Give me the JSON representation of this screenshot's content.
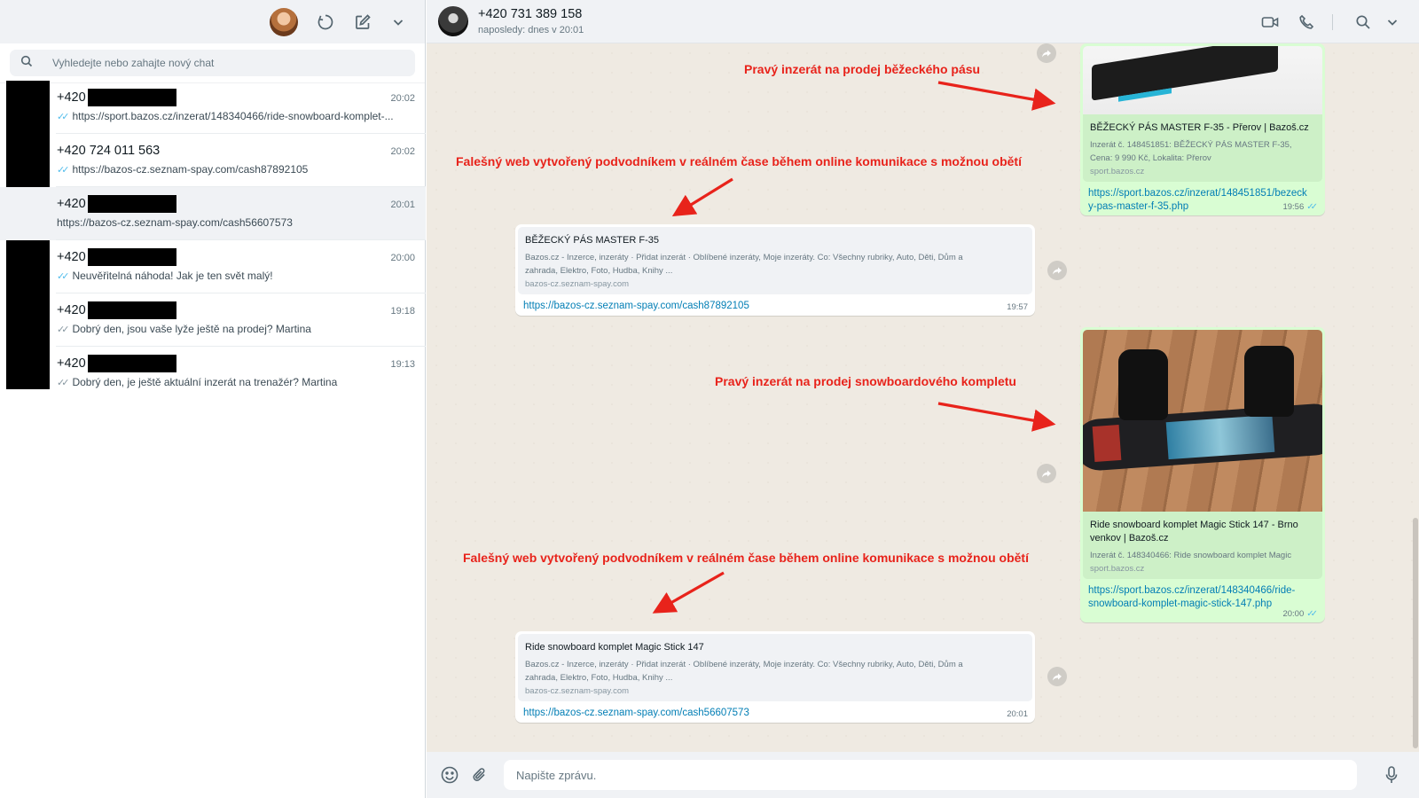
{
  "sidebar": {
    "search_placeholder": "Vyhledejte nebo zahajte nový chat",
    "icons": [
      "avatar",
      "status-icon",
      "new-chat-icon",
      "chevron-down-icon",
      "search-icon"
    ],
    "chats": [
      {
        "name": "+420",
        "time": "20:02",
        "preview": "https://sport.bazos.cz/inzerat/148340466/ride-snowboard-komplet-...",
        "ticks": "read"
      },
      {
        "name": "+420 724 011 563",
        "time": "20:02",
        "preview": "https://bazos-cz.seznam-spay.com/cash87892105",
        "ticks": "read"
      },
      {
        "name": "+420",
        "time": "20:01",
        "preview": "https://bazos-cz.seznam-spay.com/cash56607573",
        "ticks": "none"
      },
      {
        "name": "+420",
        "time": "20:00",
        "preview": "Neuvěřitelná náhoda! Jak je ten svět malý!",
        "ticks": "read"
      },
      {
        "name": "+420",
        "time": "19:18",
        "preview": "Dobrý den, jsou vaše lyže ještě na prodej? Martina",
        "ticks": "sent"
      },
      {
        "name": "+420",
        "time": "19:13",
        "preview": "Dobrý den, je ještě aktuální inzerát na trenažér? Martina",
        "ticks": "sent"
      }
    ]
  },
  "conversation": {
    "contact_name": "+420 731 389 158",
    "contact_status": "naposledy: dnes v 20:01",
    "input_placeholder": "Napište zprávu.",
    "messages": {
      "m1": {
        "title": "BĚŽECKÝ PÁS MASTER F-35 - Přerov | Bazoš.cz",
        "desc1": "Inzerát č. 148451851: BĚŽECKÝ PÁS MASTER F-35,",
        "desc2": "Cena: 9 990 Kč, Lokalita: Přerov",
        "domain": "sport.bazos.cz",
        "link1": "https://sport.bazos.cz/inzerat/148451851/bezeck",
        "link2": "y-pas-master-f-35.php",
        "time": "19:56"
      },
      "m2": {
        "title": "BĚŽECKÝ PÁS MASTER F-35",
        "desc1": "Bazos.cz - Inzerce, inzeráty · Přidat inzerát · Oblíbené inzeráty, Moje inzeráty. Co: Všechny rubriky, Auto, Děti, Dům a",
        "desc2": "zahrada, Elektro, Foto, Hudba, Knihy ...",
        "domain": "bazos-cz.seznam-spay.com",
        "link": "https://bazos-cz.seznam-spay.com/cash87892105",
        "time": "19:57"
      },
      "m3": {
        "title1": "Ride snowboard komplet Magic Stick 147 - Brno",
        "title2": "venkov | Bazoš.cz",
        "desc": "Inzerát č. 148340466: Ride snowboard komplet Magic",
        "domain": "sport.bazos.cz",
        "link1": "https://sport.bazos.cz/inzerat/148340466/ride-",
        "link2": "snowboard-komplet-magic-stick-147.php",
        "time": "20:00"
      },
      "m4": {
        "title": "Ride snowboard komplet Magic Stick 147",
        "desc1": "Bazos.cz - Inzerce, inzeráty · Přidat inzerát · Oblíbené inzeráty, Moje inzeráty. Co: Všechny rubriky, Auto, Děti, Dům a",
        "desc2": "zahrada, Elektro, Foto, Hudba, Knihy ...",
        "domain": "bazos-cz.seznam-spay.com",
        "link": "https://bazos-cz.seznam-spay.com/cash56607573",
        "time": "20:01"
      }
    }
  },
  "annotations": {
    "a1": "Pravý inzerát na prodej běžeckého pásu",
    "a2": "Falešný web vytvořený podvodníkem v reálném čase během online komunikace s možnou obětí",
    "a3": "Pravý inzerát na prodej snowboardového kompletu",
    "a4": "Falešný web vytvořený podvodníkem v reálném čase během online komunikace s možnou obětí",
    "color": "#e8231b"
  },
  "colors": {
    "outgoing_bubble": "#d9fdd3",
    "incoming_bubble": "#ffffff",
    "link": "#027eb5",
    "read_ticks": "#53bdeb",
    "chat_background": "#efeae2"
  }
}
